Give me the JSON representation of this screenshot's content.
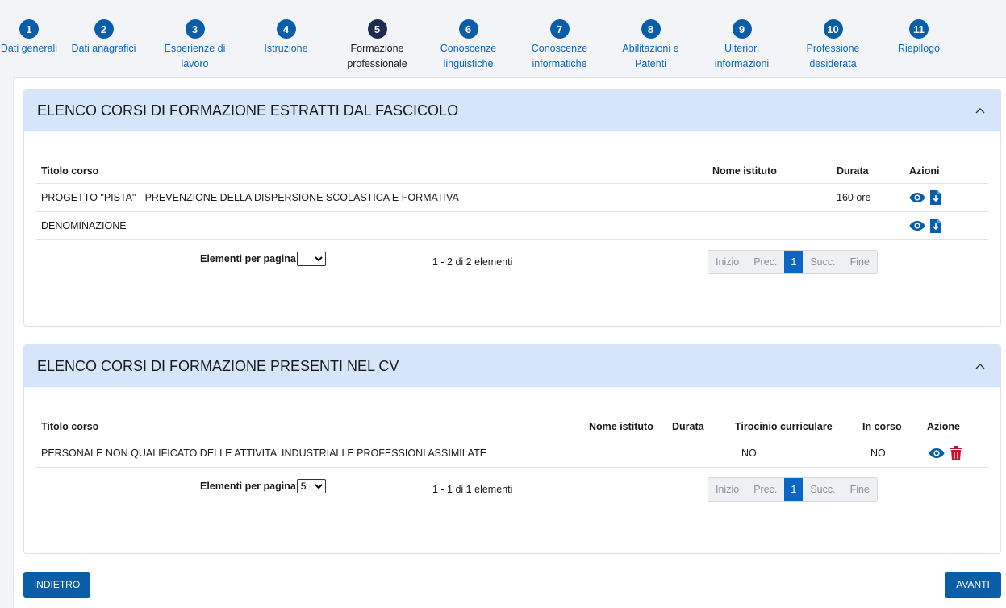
{
  "steps": [
    {
      "num": "1",
      "label": "Dati generali"
    },
    {
      "num": "2",
      "label": "Dati anagrafici"
    },
    {
      "num": "3",
      "label": "Esperienze di lavoro"
    },
    {
      "num": "4",
      "label": "Istruzione"
    },
    {
      "num": "5",
      "label": "Formazione professionale"
    },
    {
      "num": "6",
      "label": "Conoscenze linguistiche"
    },
    {
      "num": "7",
      "label": "Conoscenze informatiche"
    },
    {
      "num": "8",
      "label": "Abilitazioni e Patenti"
    },
    {
      "num": "9",
      "label": "Ulteriori informazioni"
    },
    {
      "num": "10",
      "label": "Professione desiderata"
    },
    {
      "num": "11",
      "label": "Riepilogo"
    }
  ],
  "active_step": "5",
  "fascicolo": {
    "title": "ELENCO CORSI DI FORMAZIONE ESTRATTI DAL FASCICOLO",
    "columns": {
      "titolo": "Titolo corso",
      "istituto": "Nome istituto",
      "durata": "Durata",
      "azioni": "Azioni"
    },
    "rows": [
      {
        "titolo": "PROGETTO \"PISTA\" - PREVENZIONE DELLA DISPERSIONE SCOLASTICA E FORMATIVA",
        "istituto": "",
        "durata": "160 ore"
      },
      {
        "titolo": "DENOMINAZIONE",
        "istituto": "",
        "durata": ""
      }
    ],
    "per_page_label": "Elementi per pagina",
    "per_page_value": "",
    "count": "1 - 2 di 2 elementi"
  },
  "cv": {
    "title": "ELENCO CORSI DI FORMAZIONE PRESENTI NEL CV",
    "columns": {
      "titolo": "Titolo corso",
      "istituto": "Nome istituto",
      "durata": "Durata",
      "tirocinio": "Tirocinio curriculare",
      "in_corso": "In corso",
      "azione": "Azione"
    },
    "rows": [
      {
        "titolo": "PERSONALE NON QUALIFICATO DELLE ATTIVITA' INDUSTRIALI E PROFESSIONI ASSIMILATE",
        "istituto": "",
        "durata": "",
        "tirocinio": "NO",
        "in_corso": "NO"
      }
    ],
    "per_page_label": "Elementi per pagina",
    "per_page_value": "5",
    "count": "1 - 1 di 1 elementi"
  },
  "pagination": {
    "first": "Inizio",
    "prev": "Prec.",
    "current": "1",
    "next": "Succ.",
    "last": "Fine"
  },
  "buttons": {
    "back": "INDIETRO",
    "next": "AVANTI"
  },
  "icons": {
    "view": "eye-icon",
    "download": "file-download-icon",
    "delete": "trash-icon",
    "collapse": "chevron-up-icon"
  },
  "colors": {
    "primary": "#0a5ea8",
    "active_step": "#1d2b4f",
    "panel_header": "#d6e6fa",
    "delete": "#c8102e"
  }
}
